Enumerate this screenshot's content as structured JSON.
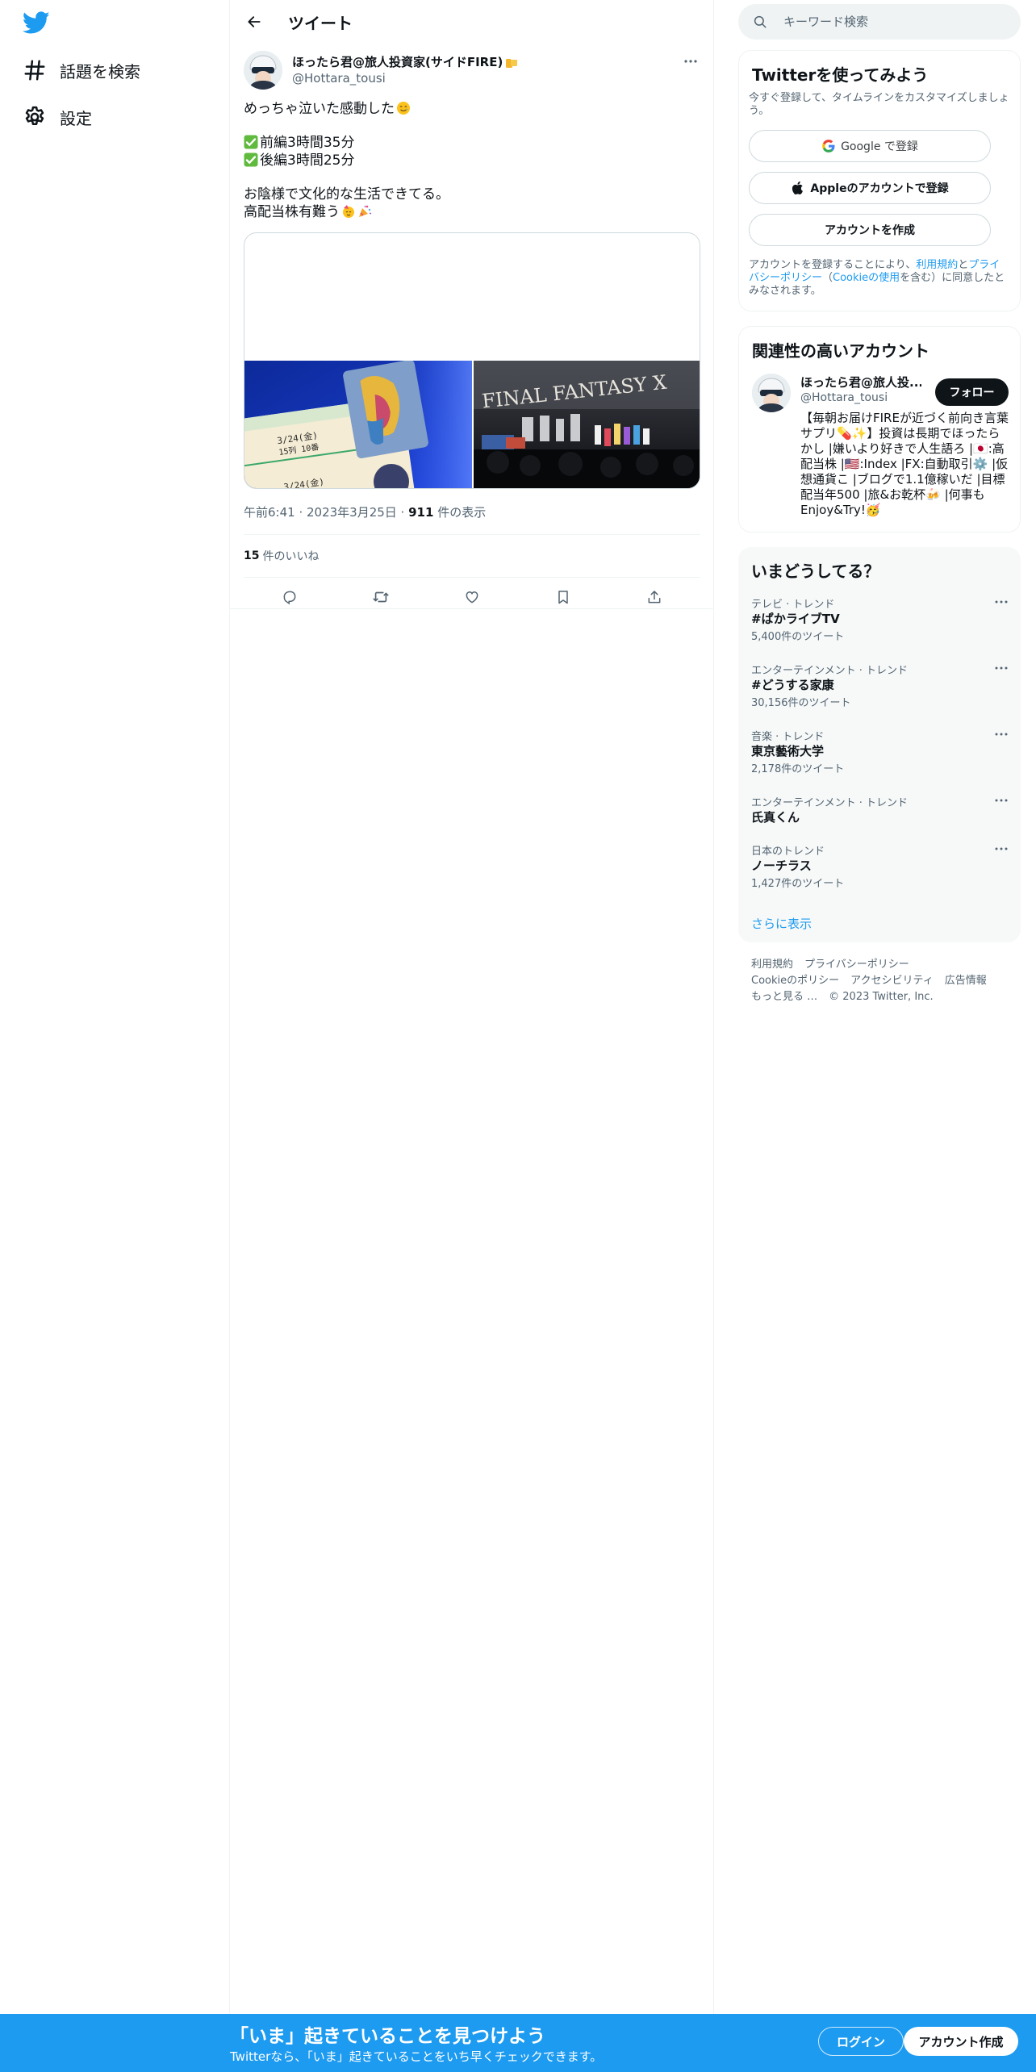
{
  "nav": {
    "logo_icon": "twitter-bird-icon",
    "items": [
      {
        "label": "話題を検索",
        "icon": "hashtag-icon"
      },
      {
        "label": "設定",
        "icon": "gear-icon"
      }
    ]
  },
  "header": {
    "title": "ツイート"
  },
  "tweet": {
    "author_name": "ほったら君@旅人投資家(サイドFIRE)",
    "author_handle": "@Hottara_tousi",
    "text_line1": "めっちゃ泣いた感動した",
    "text_line2": "前編3時間35分",
    "text_line3": "後編3時間25分",
    "text_line4": "お陰様で文化的な生活できてる。",
    "text_line5": "高配当株有難う",
    "media_right_caption": "FINAL FANTASY X",
    "timestamp": "午前6:41 · 2023年3月25日 · ",
    "views_count": "911",
    "views_label": " 件の表示",
    "likes_count": "15",
    "likes_label": "件のいいね"
  },
  "search": {
    "placeholder": "キーワード検索"
  },
  "signup": {
    "title": "Twitterを使ってみよう",
    "subtitle": "今すぐ登録して、タイムラインをカスタマイズしましょう。",
    "google_label": "Google で登録",
    "apple_label": "Appleのアカウントで登録",
    "create_label": "アカウントを作成",
    "legal_pre": "アカウントを登録することにより、",
    "legal_terms": "利用規約",
    "legal_and": "と",
    "legal_privacy": "プライバシーポリシー",
    "legal_mid": "（",
    "legal_cookie": "Cookieの使用",
    "legal_post": "を含む）に同意したとみなされます。"
  },
  "related": {
    "title": "関連性の高いアカウント",
    "name": "ほったら君@旅人投...",
    "handle": "@Hottara_tousi",
    "follow_label": "フォロー",
    "bio": "【毎朝お届けFIREが近づく前向き言葉サプリ💊✨】投資は長期でほったらかし |嫌いより好きで人生語ろ |🇯🇵:高配当株 |🇺🇸:Index |FX:自動取引⚙️ |仮想通貨こ |ブログで1.1億稼いだ |目標配当年500 |旅&お乾杯🍻 |何事もEnjoy&Try!🥳"
  },
  "trends": {
    "title": "いまどうしてる？",
    "items": [
      {
        "meta": "テレビ · トレンド",
        "name": "#ぱかライブTV",
        "count": "5,400件のツイート"
      },
      {
        "meta": "エンターテインメント · トレンド",
        "name": "#どうする家康",
        "count": "30,156件のツイート"
      },
      {
        "meta": "音楽 · トレンド",
        "name": "東京藝術大学",
        "count": "2,178件のツイート"
      },
      {
        "meta": "エンターテインメント · トレンド",
        "name": "氏真くん",
        "count": ""
      },
      {
        "meta": "日本のトレンド",
        "name": "ノーチラス",
        "count": "1,427件のツイート"
      }
    ],
    "show_more": "さらに表示"
  },
  "footer": {
    "terms": "利用規約",
    "privacy": "プライバシーポリシー",
    "cookie": "Cookieのポリシー",
    "accessibility": "アクセシビリティ",
    "ads": "広告情報",
    "more": "もっと見る …",
    "copyright": "© 2023 Twitter, Inc."
  },
  "bottom_bar": {
    "title": "「いま」起きていることを見つけよう",
    "subtitle": "Twitterなら、「いま」起きていることをいち早くチェックできます。",
    "login_label": "ログイン",
    "signup_label": "アカウント作成"
  },
  "colors": {
    "accent": "#1d9bf0",
    "text": "#0f1419",
    "secondary": "#536471",
    "check": "#5fba3d"
  }
}
